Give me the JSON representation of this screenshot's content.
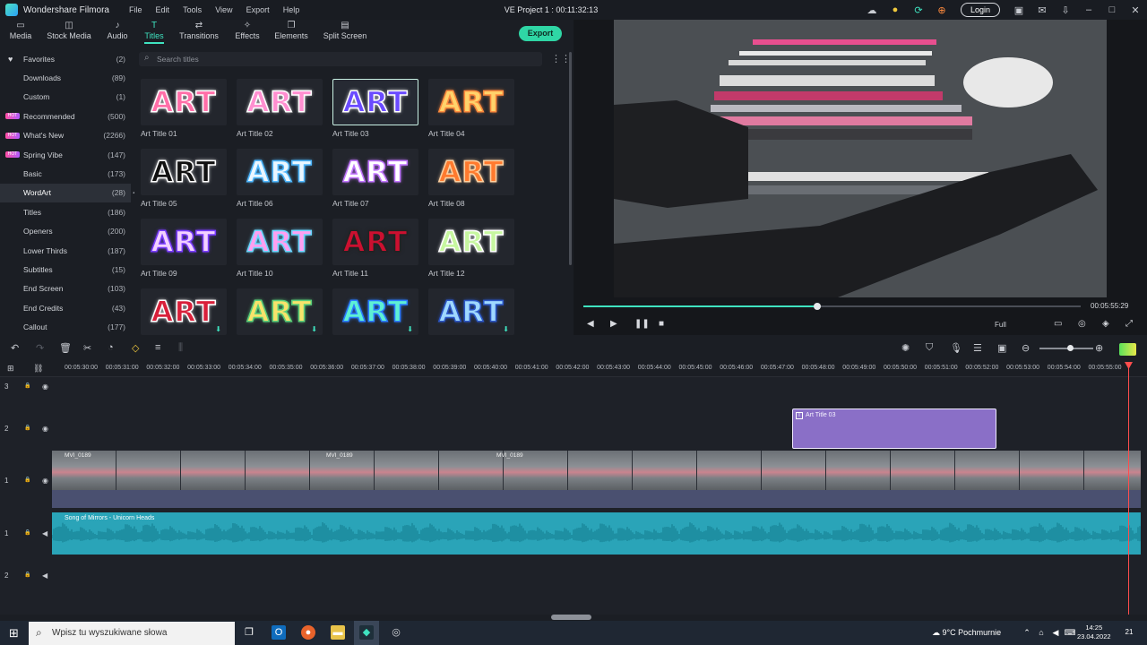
{
  "app": {
    "name": "Wondershare Filmora",
    "menu": [
      "File",
      "Edit",
      "Tools",
      "View",
      "Export",
      "Help"
    ],
    "project_title": "VE Project 1 : 00:11:32:13",
    "login_label": "Login"
  },
  "toolbar": {
    "tabs": [
      {
        "label": "Media",
        "icon": "folder-icon"
      },
      {
        "label": "Stock Media",
        "icon": "stock-icon"
      },
      {
        "label": "Audio",
        "icon": "music-icon"
      },
      {
        "label": "Titles",
        "icon": "text-icon",
        "active": true
      },
      {
        "label": "Transitions",
        "icon": "transition-icon"
      },
      {
        "label": "Effects",
        "icon": "effects-icon"
      },
      {
        "label": "Elements",
        "icon": "elements-icon"
      },
      {
        "label": "Split Screen",
        "icon": "split-screen-icon"
      }
    ],
    "export_label": "Export"
  },
  "sidebar": {
    "items": [
      {
        "label": "Favorites",
        "count": "(2)"
      },
      {
        "label": "Downloads",
        "count": "(89)"
      },
      {
        "label": "Custom",
        "count": "(1)"
      },
      {
        "label": "Recommended",
        "count": "(500)"
      },
      {
        "label": "What's New",
        "count": "(2266)"
      },
      {
        "label": "Spring Vibe",
        "count": "(147)"
      },
      {
        "label": "Basic",
        "count": "(173)"
      },
      {
        "label": "WordArt",
        "count": "(28)",
        "active": true
      },
      {
        "label": "Titles",
        "count": "(186)"
      },
      {
        "label": "Openers",
        "count": "(200)"
      },
      {
        "label": "Lower Thirds",
        "count": "(187)"
      },
      {
        "label": "Subtitles",
        "count": "(15)"
      },
      {
        "label": "End Screen",
        "count": "(103)"
      },
      {
        "label": "End Credits",
        "count": "(43)"
      },
      {
        "label": "Callout",
        "count": "(177)"
      }
    ],
    "badge_text": "HOT"
  },
  "search": {
    "placeholder": "Search titles"
  },
  "titles": {
    "tile_text": "ART",
    "items": [
      {
        "label": "Art Title 01",
        "fill": "#ff6fa8",
        "stroke": "#ffffff"
      },
      {
        "label": "Art Title 02",
        "fill": "#ff8fd0",
        "stroke": "#ffffff"
      },
      {
        "label": "Art Title 03",
        "fill": "#6a4bff",
        "stroke": "#ffffff",
        "selected": true
      },
      {
        "label": "Art Title 04",
        "fill": "#ffd36b",
        "stroke": "#ff8a3d"
      },
      {
        "label": "Art Title 05",
        "fill": "#111111",
        "stroke": "#ffffff"
      },
      {
        "label": "Art Title 06",
        "fill": "#eaf6ff",
        "stroke": "#4fb8ff"
      },
      {
        "label": "Art Title 07",
        "fill": "#ffffff",
        "stroke": "#c276ff"
      },
      {
        "label": "Art Title 08",
        "fill": "#ff7a2e",
        "stroke": "#ffd0a0"
      },
      {
        "label": "Art Title 09",
        "fill": "#f3d1ff",
        "stroke": "#7a3cff"
      },
      {
        "label": "Art Title 10",
        "fill": "#ff9ff0",
        "stroke": "#6ad7ff"
      },
      {
        "label": "Art Title 11",
        "fill": "#cc1030",
        "stroke": "#222222"
      },
      {
        "label": "Art Title 12",
        "fill": "#c7f7a0",
        "stroke": "#ffffff"
      },
      {
        "label": "",
        "fill": "#d8203a",
        "stroke": "#ffffff",
        "download": true
      },
      {
        "label": "",
        "fill": "#f7e36b",
        "stroke": "#5ad07a",
        "download": true
      },
      {
        "label": "",
        "fill": "#5ef0d4",
        "stroke": "#2a7bff",
        "download": true
      },
      {
        "label": "",
        "fill": "#9fd8ff",
        "stroke": "#2b56c7",
        "download": true
      }
    ]
  },
  "preview": {
    "timecode": "00:05:55:29",
    "progress_percent": 47,
    "quality_label": "Full"
  },
  "timeline": {
    "ruler": [
      "00:05:30:00",
      "00:05:31:00",
      "00:05:32:00",
      "00:05:33:00",
      "00:05:34:00",
      "00:05:35:00",
      "00:05:36:00",
      "00:05:37:00",
      "00:05:38:00",
      "00:05:39:00",
      "00:05:40:00",
      "00:05:41:00",
      "00:05:42:00",
      "00:05:43:00",
      "00:05:44:00",
      "00:05:45:00",
      "00:05:46:00",
      "00:05:47:00",
      "00:05:48:00",
      "00:05:49:00",
      "00:05:50:00",
      "00:05:51:00",
      "00:05:52:00",
      "00:05:53:00",
      "00:05:54:00",
      "00:05:55:00"
    ],
    "tracks": [
      {
        "id": "3",
        "type": "video"
      },
      {
        "id": "2",
        "type": "video"
      },
      {
        "id": "1",
        "type": "video"
      },
      {
        "id": "1",
        "type": "audio"
      },
      {
        "id": "2",
        "type": "audio"
      }
    ],
    "title_clip_label": "Art Title 03",
    "video_clips": [
      "MVI_0189",
      "MVI_0189",
      "MVI_0189"
    ],
    "audio_clip_label": "Song of Mirrors - Unicorn Heads"
  },
  "taskbar": {
    "search_placeholder": "Wpisz tu wyszukiwane słowa",
    "weather": "9°C  Pochmurnie",
    "time": "14:25",
    "date": "23.04.2022",
    "notifications": "21"
  },
  "colors": {
    "accent": "#3fe3c0",
    "title_clip": "#8a6fc7",
    "audio_clip": "#2aa4b8",
    "playhead": "#ff4d4d"
  }
}
